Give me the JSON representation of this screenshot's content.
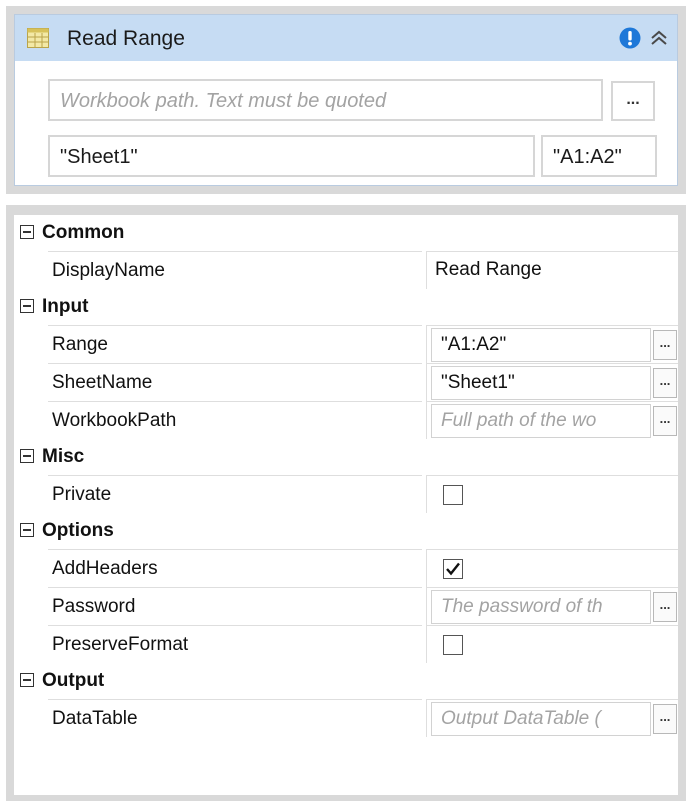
{
  "activity": {
    "title": "Read Range",
    "workbook_placeholder": "Workbook path. Text must be quoted",
    "browse_label": "...",
    "sheet_value": "\"Sheet1\"",
    "range_value": "\"A1:A2\"",
    "icons": {
      "activity": "excel-sheet-icon",
      "warning": "warning-icon",
      "collapse": "collapse-icon"
    },
    "colors": {
      "header": "#c6dcf3",
      "warning": "#1e78d8"
    }
  },
  "properties": {
    "categories": {
      "common": "Common",
      "input": "Input",
      "misc": "Misc",
      "options": "Options",
      "output": "Output"
    },
    "display_name": {
      "label": "DisplayName",
      "value": "Read Range"
    },
    "range": {
      "label": "Range",
      "value": "\"A1:A2\""
    },
    "sheet_name": {
      "label": "SheetName",
      "value": "\"Sheet1\""
    },
    "workbook_path": {
      "label": "WorkbookPath",
      "placeholder": "Full path of the wo"
    },
    "private": {
      "label": "Private",
      "checked": false
    },
    "add_headers": {
      "label": "AddHeaders",
      "checked": true
    },
    "password": {
      "label": "Password",
      "placeholder": "The password of th"
    },
    "preserve_format": {
      "label": "PreserveFormat",
      "checked": false
    },
    "data_table": {
      "label": "DataTable",
      "placeholder": "Output DataTable ("
    },
    "browse_label": "..."
  }
}
